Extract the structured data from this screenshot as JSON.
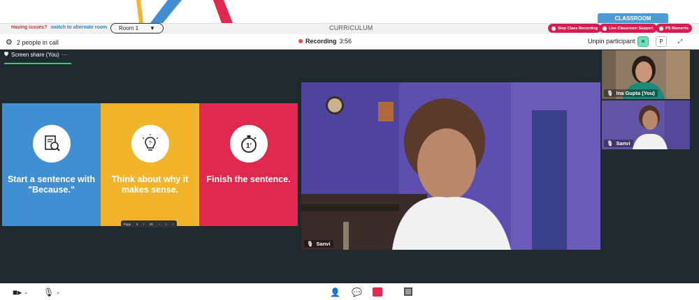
{
  "header": {
    "issues_text": "Having issues?",
    "switch_link": "switch to alternate room",
    "room_select": "Room 1",
    "curriculum_label": "CURRICULUM",
    "classroom_tab": "CLASSROOM",
    "actions": [
      {
        "label": "Stop Class Recording"
      },
      {
        "label": "Live Classroom Support"
      },
      {
        "label": "PS Moments"
      }
    ]
  },
  "callbar": {
    "people_count": "2 people in call",
    "recording_label": "Recording",
    "recording_time": "3:56",
    "unpin_label": "Unpin participant",
    "p_button": "P"
  },
  "screen_share": {
    "tab_label": "Screen share (You)",
    "more": "···",
    "slide_panels": [
      {
        "text": "Start a sentence with \"Because.\"",
        "color": "#3f8fd2",
        "icon": "document-magnifier-icon"
      },
      {
        "text": "Think about why it makes sense.",
        "color": "#f2b42a",
        "icon": "lightbulb-icon"
      },
      {
        "text": "Finish the sentence.",
        "color": "#e0284f",
        "icon": "stopwatch-icon"
      }
    ],
    "stopwatch_text": "1'",
    "slide_controls": {
      "page_label": "Page",
      "page_num": "4",
      "page_sep": "/",
      "page_total": "38"
    }
  },
  "participants": {
    "main": {
      "name": "Sanvi"
    },
    "thumbs": [
      {
        "name": "Ina Gupta (You)"
      },
      {
        "name": "Sanvi"
      }
    ]
  },
  "colors": {
    "accent_red": "#d81b50",
    "accent_blue": "#4a9bd6",
    "stage_bg": "#1f2a2e"
  }
}
